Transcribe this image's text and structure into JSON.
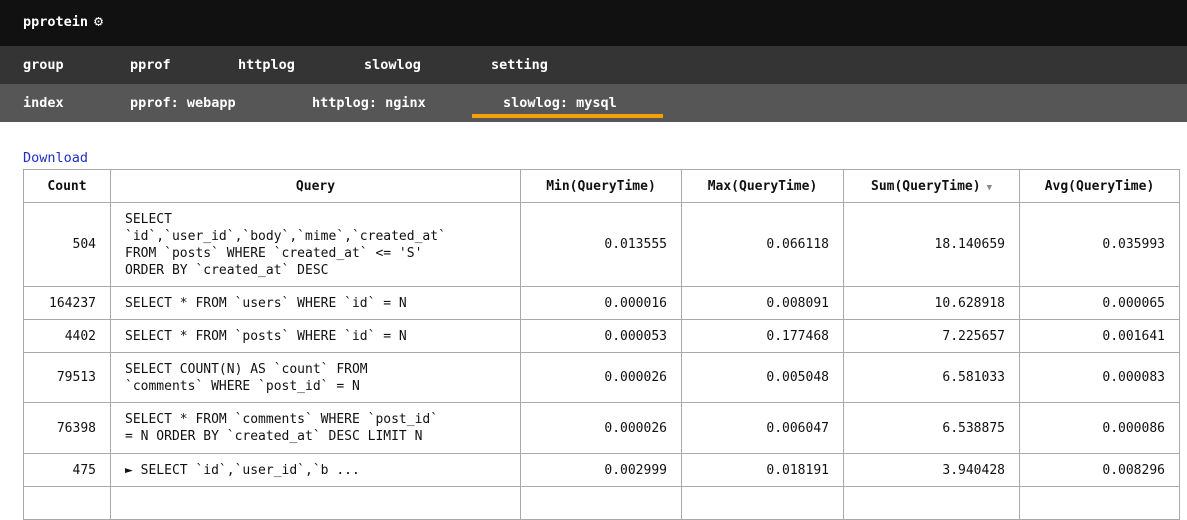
{
  "app": {
    "title": "pprotein",
    "settings_icon": "gear-icon"
  },
  "nav_primary": [
    {
      "label": "group"
    },
    {
      "label": "pprof"
    },
    {
      "label": "httplog"
    },
    {
      "label": "slowlog"
    },
    {
      "label": "setting"
    }
  ],
  "nav_secondary": [
    {
      "label": "index",
      "active": false
    },
    {
      "label": "pprof: webapp",
      "active": false
    },
    {
      "label": "httplog: nginx",
      "active": false
    },
    {
      "label": "slowlog: mysql",
      "active": true
    }
  ],
  "download_label": "Download",
  "table": {
    "columns": [
      "Count",
      "Query",
      "Min(QueryTime)",
      "Max(QueryTime)",
      "Sum(QueryTime)",
      "Avg(QueryTime)"
    ],
    "sort_column": "Sum(QueryTime)",
    "sort_direction": "descending",
    "rows": [
      {
        "count": "504",
        "query": "SELECT\n`id`,`user_id`,`body`,`mime`,`created_at`\nFROM `posts` WHERE `created_at` <= 'S'\nORDER BY `created_at` DESC",
        "min": "0.013555",
        "max": "0.066118",
        "sum": "18.140659",
        "avg": "0.035993"
      },
      {
        "count": "164237",
        "query": "SELECT * FROM `users` WHERE `id` = N",
        "min": "0.000016",
        "max": "0.008091",
        "sum": "10.628918",
        "avg": "0.000065"
      },
      {
        "count": "4402",
        "query": "SELECT * FROM `posts` WHERE `id` = N",
        "min": "0.000053",
        "max": "0.177468",
        "sum": "7.225657",
        "avg": "0.001641"
      },
      {
        "count": "79513",
        "query": "SELECT COUNT(N) AS `count` FROM\n`comments` WHERE `post_id` = N",
        "min": "0.000026",
        "max": "0.005048",
        "sum": "6.581033",
        "avg": "0.000083"
      },
      {
        "count": "76398",
        "query": "SELECT * FROM `comments` WHERE `post_id`\n= N ORDER BY `created_at` DESC LIMIT N",
        "min": "0.000026",
        "max": "0.006047",
        "sum": "6.538875",
        "avg": "0.000086"
      },
      {
        "count": "475",
        "query": "► SELECT `id`,`user_id`,`b ...",
        "min": "0.002999",
        "max": "0.018191",
        "sum": "3.940428",
        "avg": "0.008296"
      },
      {
        "count": "",
        "query": "",
        "min": "",
        "max": "",
        "sum": "",
        "avg": ""
      }
    ]
  }
}
